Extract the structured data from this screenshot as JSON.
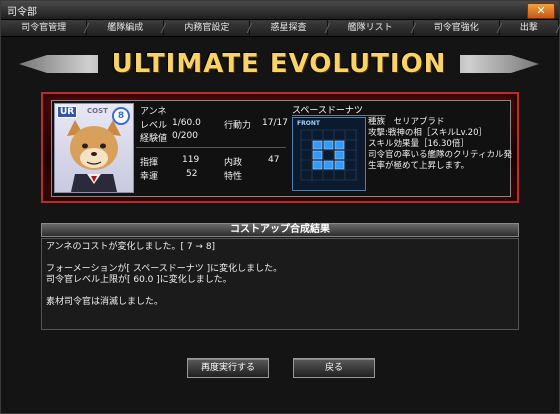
{
  "window": {
    "title": "司令部",
    "close_icon": "close-icon"
  },
  "tabs": [
    "司令官管理",
    "艦隊編成",
    "内務官設定",
    "惑星探査",
    "艦隊リスト",
    "司令官強化",
    "出撃"
  ],
  "banner": {
    "title": "ULTIMATE EVOLUTION"
  },
  "card": {
    "rarity": "UR",
    "cost_label": "COST",
    "cost_value": "8",
    "name": "アンネ",
    "level_label": "レベル",
    "level_value": "1/60.0",
    "action_label": "行動力",
    "action_value": "17/17",
    "exp_label": "経験値",
    "exp_value": "0/200",
    "command_label": "指揮",
    "command_value": "119",
    "internal_label": "内政",
    "internal_value": "47",
    "luck_label": "幸運",
    "luck_value": "52",
    "trait_label": "特性",
    "trait_value": ""
  },
  "formation": {
    "name": "スペースドーナツ",
    "front_label": "FRONT",
    "desc": [
      "種族　セリアブラド",
      "攻撃:戦神の相［スキルLv.20］",
      "スキル効果量［16.30倍］",
      "司令官の率いる艦隊のクリティカル発",
      "生率が極めて上昇します。"
    ],
    "highlight_color": "#2f9bff"
  },
  "result": {
    "header": "コストアップ合成結果",
    "lines": [
      "アンネのコストが変化しました。[ 7 → 8]",
      "",
      "フォーメーションが[ スペースドーナツ ]に変化しました。",
      "司令官レベル上限が[ 60.0 ]に変化しました。",
      "",
      "素材司令官は消滅しました。"
    ]
  },
  "buttons": {
    "retry": "再度実行する",
    "back": "戻る"
  }
}
